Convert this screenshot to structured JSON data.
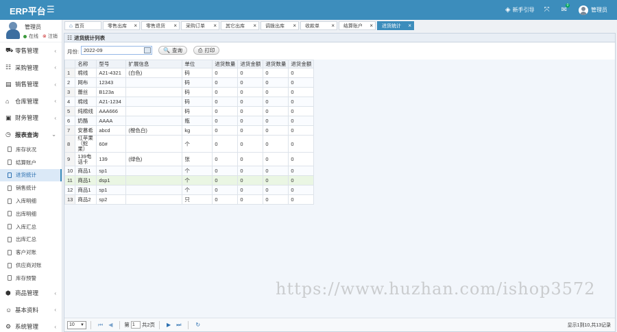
{
  "topbar": {
    "brand": "ERP平台",
    "guide_label": "新手引导",
    "mail_count": "0",
    "user_label": "管理员"
  },
  "user": {
    "name": "管理员",
    "status": "在线",
    "logout": "注销"
  },
  "nav": {
    "groups_top": [
      {
        "label": "零售管理",
        "icon": "cart-icon"
      },
      {
        "label": "采购管理",
        "icon": "list-icon"
      },
      {
        "label": "销售管理",
        "icon": "book-icon"
      },
      {
        "label": "仓库管理",
        "icon": "home-icon"
      },
      {
        "label": "财务管理",
        "icon": "money-icon"
      },
      {
        "label": "报表查询",
        "icon": "clock-icon"
      }
    ],
    "subitems": [
      "库存状况",
      "结算账户",
      "进货统计",
      "销售统计",
      "入库明细",
      "出库明细",
      "入库汇总",
      "出库汇总",
      "客户对账",
      "供应商对账",
      "库存预警"
    ],
    "groups_bottom": [
      {
        "label": "商品管理",
        "icon": "cube-icon"
      },
      {
        "label": "基本资料",
        "icon": "user-icon"
      },
      {
        "label": "系统管理",
        "icon": "gear-icon"
      }
    ]
  },
  "tabs": [
    "首页",
    "零售出库",
    "零售退货",
    "采购订单",
    "其它出库",
    "调拨出库",
    "收款单",
    "结算账户",
    "进货统计"
  ],
  "panel": {
    "title": "进货统计列表",
    "month_label": "月份:",
    "month_value": "2022-09",
    "query_label": "查询",
    "print_label": "打印"
  },
  "table": {
    "headers": [
      "名称",
      "型号",
      "扩展信息",
      "单位",
      "进货数量",
      "进货金额",
      "退货数量",
      "退货金额"
    ],
    "rows": [
      [
        "1",
        "棉线",
        "A21-4321",
        "(白色)",
        "码",
        "0",
        "0",
        "0",
        "0"
      ],
      [
        "2",
        "网布",
        "12343",
        "",
        "码",
        "0",
        "0",
        "0",
        "0"
      ],
      [
        "3",
        "蕾丝",
        "B123a",
        "",
        "码",
        "0",
        "0",
        "0",
        "0"
      ],
      [
        "4",
        "棉线",
        "A21-1234",
        "",
        "码",
        "0",
        "0",
        "0",
        "0"
      ],
      [
        "5",
        "纯棉线",
        "AAA666",
        "",
        "码",
        "0",
        "0",
        "0",
        "0"
      ],
      [
        "6",
        "奶酪",
        "AAAA",
        "",
        "瓶",
        "0",
        "0",
        "0",
        "0"
      ],
      [
        "7",
        "安慕希",
        "abcd",
        "(橙色白)",
        "kg",
        "0",
        "0",
        "0",
        "0"
      ],
      [
        "8",
        "红苹果（蛇果）",
        "60#",
        "",
        "个",
        "0",
        "0",
        "0",
        "0"
      ],
      [
        "9",
        "139电话卡",
        "139",
        "(绿色)",
        "张",
        "0",
        "0",
        "0",
        "0"
      ],
      [
        "10",
        "商品1",
        "sp1",
        "",
        "个",
        "0",
        "0",
        "0",
        "0"
      ],
      [
        "11",
        "商品1",
        "dsp1",
        "",
        "个",
        "0",
        "0",
        "0",
        "0"
      ],
      [
        "12",
        "商品1",
        "sp1",
        "",
        "个",
        "0",
        "0",
        "0",
        "0"
      ],
      [
        "13",
        "商品2",
        "sp2",
        "",
        "只",
        "0",
        "0",
        "0",
        "0"
      ]
    ]
  },
  "pager": {
    "page_size": "10",
    "page_prefix": "第",
    "page_value": "1",
    "page_suffix": "共2页",
    "info": "显示1到10,共13记录"
  },
  "watermark": "https://www.huzhan.com/ishop3572"
}
